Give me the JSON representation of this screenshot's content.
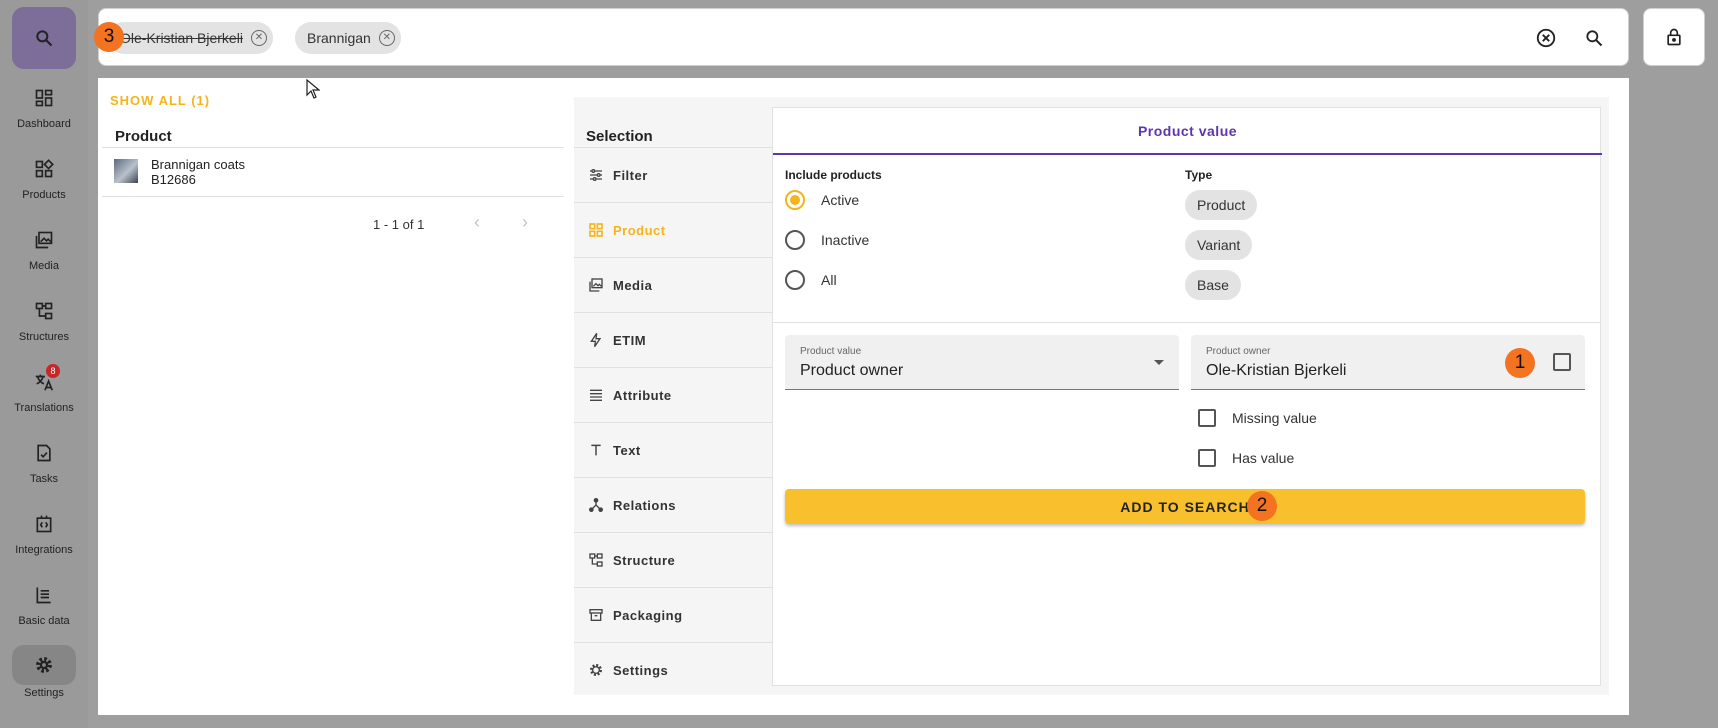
{
  "rail": {
    "items": [
      {
        "label": "Dashboard",
        "icon": "dashboard-icon"
      },
      {
        "label": "Products",
        "icon": "products-icon"
      },
      {
        "label": "Media",
        "icon": "media-icon"
      },
      {
        "label": "Structures",
        "icon": "structures-icon"
      },
      {
        "label": "Translations",
        "icon": "translate-icon",
        "badge": "8"
      },
      {
        "label": "Tasks",
        "icon": "tasks-icon"
      },
      {
        "label": "Integrations",
        "icon": "integrations-icon"
      },
      {
        "label": "Basic data",
        "icon": "basic-data-icon"
      },
      {
        "label": "Settings",
        "icon": "gear-icon"
      }
    ]
  },
  "search": {
    "chips": [
      {
        "label": "Ole-Kristian Bjerkeli",
        "struck": true
      },
      {
        "label": "Brannigan",
        "struck": false
      }
    ]
  },
  "markers": {
    "one": "1",
    "two": "2",
    "three": "3"
  },
  "results": {
    "show_all": "SHOW ALL (1)",
    "column_header": "Product",
    "rows": [
      {
        "name": "Brannigan coats",
        "code": "B12686"
      }
    ],
    "pager": "1 - 1 of 1"
  },
  "selection": {
    "header": "Selection",
    "nav": [
      {
        "label": "Filter",
        "icon": "filter-icon",
        "active": false
      },
      {
        "label": "Product",
        "icon": "products-icon",
        "active": true
      },
      {
        "label": "Media",
        "icon": "media-icon",
        "active": false
      },
      {
        "label": "ETIM",
        "icon": "bolt-icon",
        "active": false
      },
      {
        "label": "Attribute",
        "icon": "list-icon",
        "active": false
      },
      {
        "label": "Text",
        "icon": "text-icon",
        "active": false
      },
      {
        "label": "Relations",
        "icon": "relations-icon",
        "active": false
      },
      {
        "label": "Structure",
        "icon": "structures-icon",
        "active": false
      },
      {
        "label": "Packaging",
        "icon": "packaging-icon",
        "active": false
      },
      {
        "label": "Settings",
        "icon": "gear-icon",
        "active": false
      }
    ]
  },
  "card": {
    "title": "Product value",
    "include_header": "Include products",
    "include_options": [
      {
        "label": "Active",
        "selected": true
      },
      {
        "label": "Inactive",
        "selected": false
      },
      {
        "label": "All",
        "selected": false
      }
    ],
    "type_header": "Type",
    "types": [
      "Product",
      "Variant",
      "Base"
    ],
    "product_value_field": {
      "label": "Product value",
      "value": "Product owner"
    },
    "owner_field": {
      "label": "Product owner",
      "value": "Ole-Kristian Bjerkeli"
    },
    "missing_value": "Missing value",
    "has_value": "Has value",
    "add_button": "ADD TO SEARCH"
  },
  "colors": {
    "accent": "#f3b41c",
    "primary": "#5e35b1",
    "marker": "#f37321"
  }
}
